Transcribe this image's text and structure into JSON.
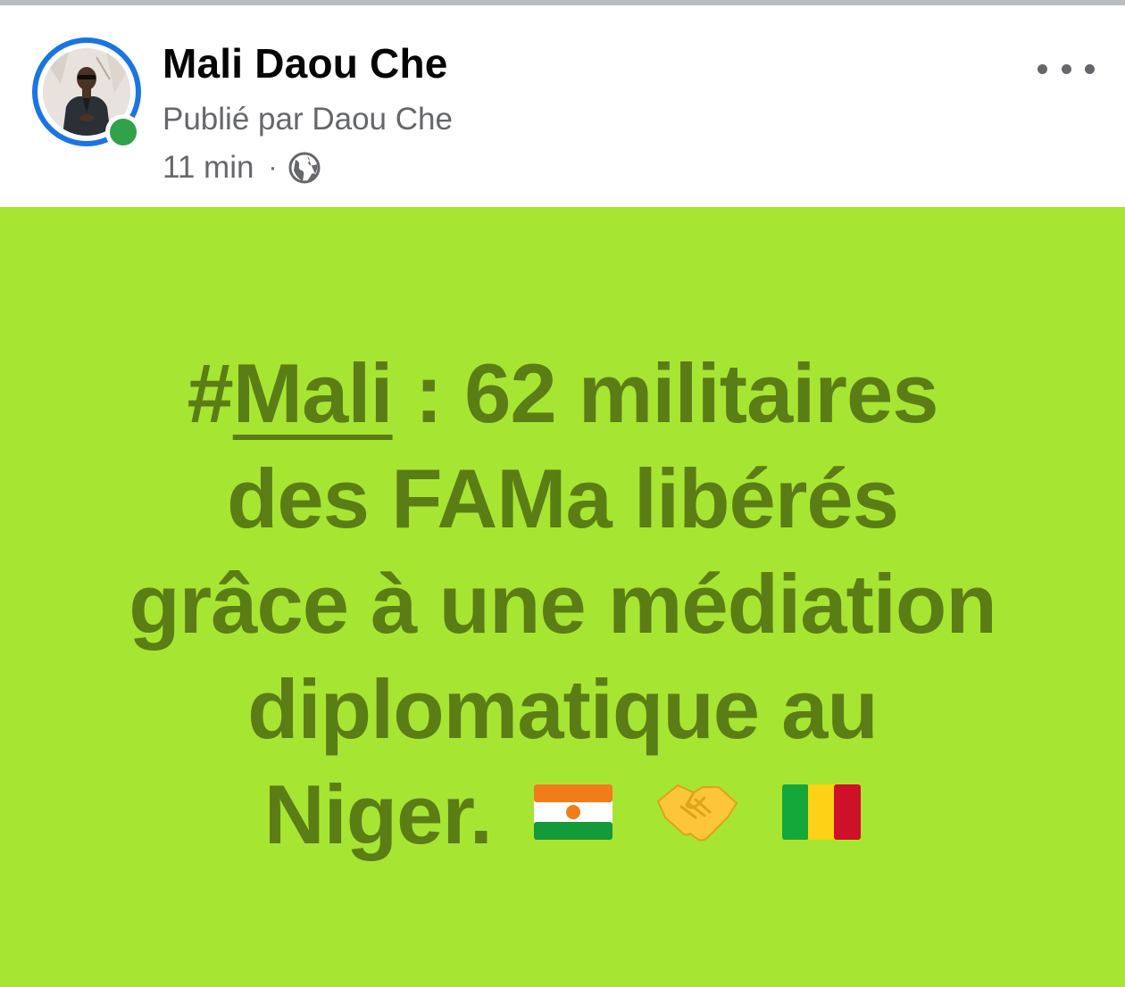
{
  "post": {
    "author_name": "Mali Daou Che",
    "published_by": "Publié par Daou Che",
    "time": "11 min",
    "separator": "·",
    "privacy_icon": "globe-icon",
    "more_icon": "more-dots-icon",
    "avatar_online": true
  },
  "content": {
    "hashtag": "#",
    "hashtag_word": "Mali",
    "line1_rest": " : 62 militaires",
    "line2": "des FAMa libérés",
    "line3": "grâce à une médiation",
    "line4": "diplomatique au",
    "line5": "Niger.",
    "emojis": [
      "niger-flag-icon",
      "handshake-icon",
      "mali-flag-icon"
    ]
  },
  "colors": {
    "post_background": "#a7e533",
    "post_text": "#5b7d16",
    "story_ring": "#1b74e4",
    "online_dot": "#31a24c",
    "secondary_text": "#65676b",
    "primary_text": "#050505"
  }
}
